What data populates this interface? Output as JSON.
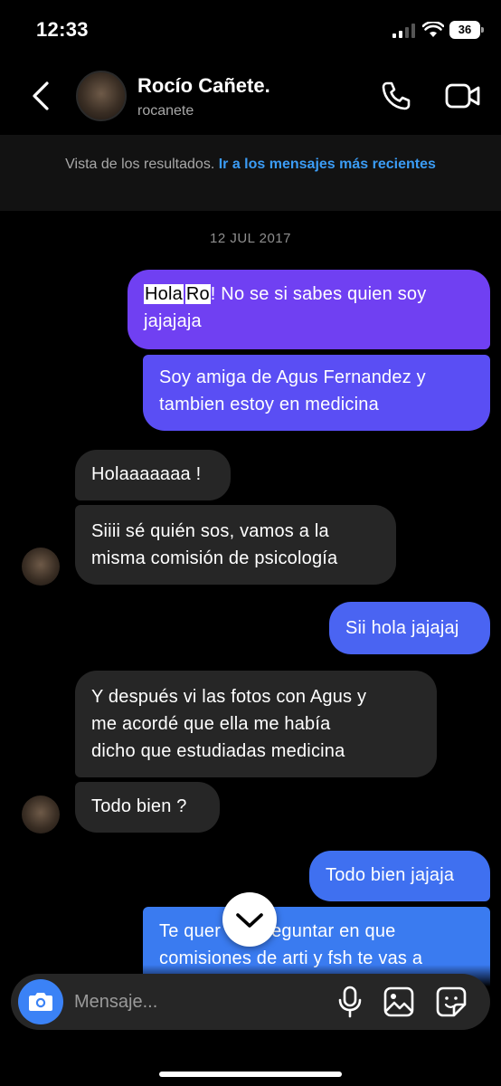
{
  "status": {
    "time": "12:33",
    "battery": "36"
  },
  "header": {
    "name": "Rocío Cañete.",
    "handle": "rocanete"
  },
  "banner": {
    "text": "Vista de los resultados.",
    "link": "Ir a los mensajes más recientes"
  },
  "date": "12 JUL 2017",
  "messages": {
    "m1": {
      "hl1": "Hola",
      "hl2": "Ro",
      "rest": "! No se si sabes quien soy jajajaja"
    },
    "m2": {
      "line1": "Soy amiga de Agus Fernandez y",
      "line2": "tambien estoy en medicina"
    },
    "m3": {
      "text": "Holaaaaaaa !"
    },
    "m4": {
      "line1": "Siiii sé quién sos, vamos a la",
      "line2": "misma comisión de psicología"
    },
    "m5": {
      "text": "Sii hola jajajaj"
    },
    "m6": {
      "line1": "Y después vi las fotos con Agus y",
      "line2": "me acordé que ella me había",
      "line3": "dicho que estudiadas medicina"
    },
    "m7": {
      "text": "Todo bien ?"
    },
    "m8": {
      "text": "Todo bien jajaja"
    },
    "m9": {
      "line1a": "Te quer",
      "line1b": "eguntar en que",
      "line2": "comisiones de arti y fsh te vas a"
    }
  },
  "composer": {
    "placeholder": "Mensaje..."
  },
  "colors": {
    "outgoing_top": "#7b3ff2",
    "outgoing_mid": "#5b4ff5",
    "outgoing_bottom": "#3b78f0",
    "incoming": "#262626",
    "link": "#3b9cf5",
    "camera": "#3b82f6"
  },
  "icons": [
    "back-chevron-icon",
    "phone-icon",
    "video-icon",
    "camera-icon",
    "mic-icon",
    "gallery-icon",
    "sticker-icon",
    "chevron-down-icon"
  ]
}
